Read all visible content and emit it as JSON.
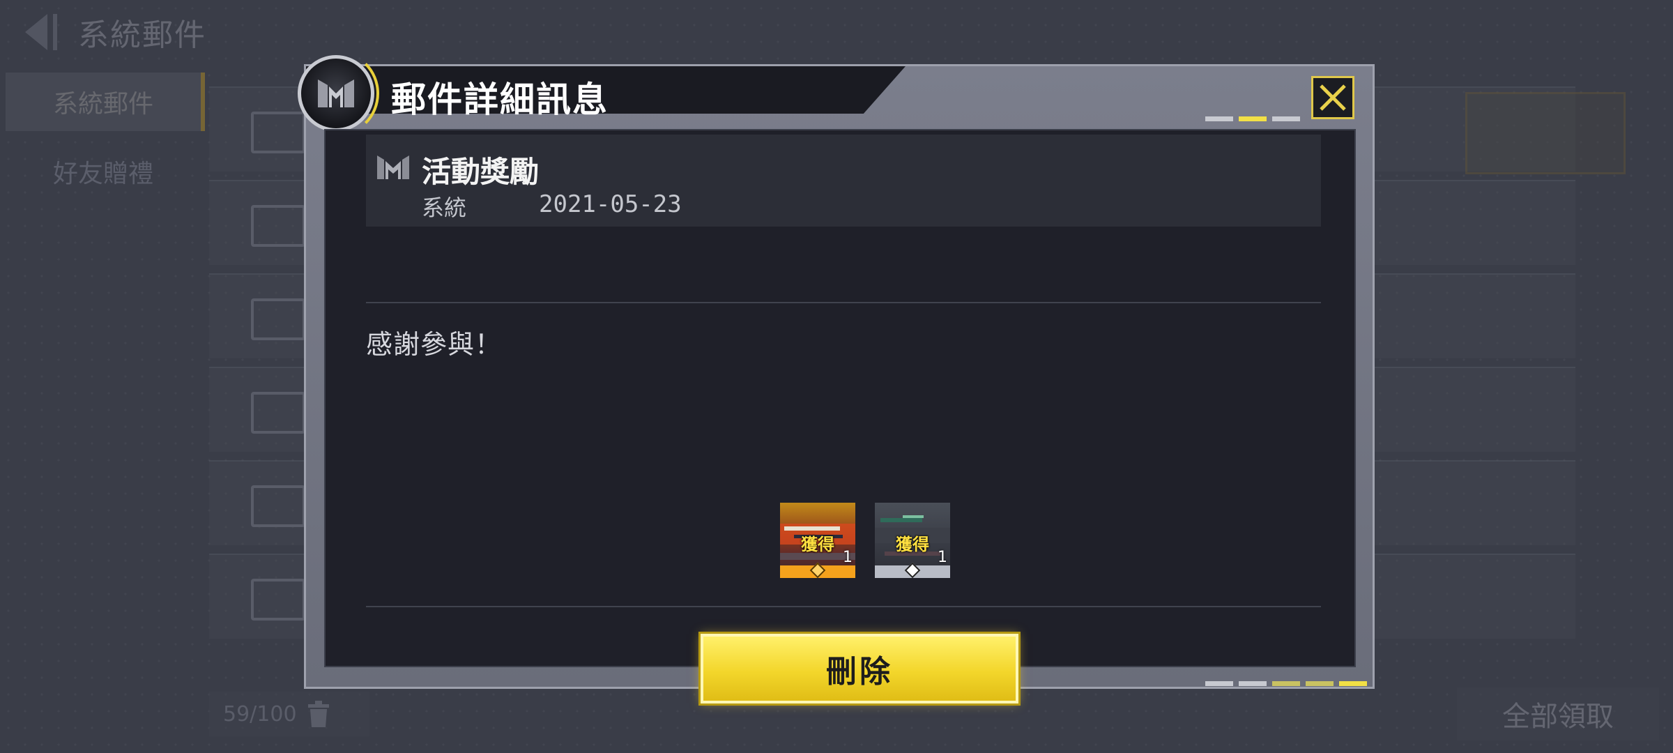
{
  "background": {
    "title": "系統郵件",
    "sidebar": [
      {
        "label": "系統郵件",
        "active": true
      },
      {
        "label": "好友贈禮",
        "active": false
      }
    ],
    "mail_counter": "59/100",
    "claim_all_label": "全部領取"
  },
  "dialog": {
    "title": "郵件詳細訊息",
    "mail": {
      "subject": "活動獎勵",
      "sender": "系統",
      "date": "2021-05-23",
      "body": "感謝參與！"
    },
    "rewards": [
      {
        "status": "獲得",
        "quantity": "1",
        "rarity_color": "#f5a21c",
        "icon": "weapon-skin-orange"
      },
      {
        "status": "獲得",
        "quantity": "1",
        "rarity_color": "#b8bcc6",
        "icon": "weapon-skin-gray"
      }
    ],
    "delete_label": "刪除",
    "colors": {
      "accent": "#f3d62b",
      "panel": "#1f2029"
    }
  }
}
